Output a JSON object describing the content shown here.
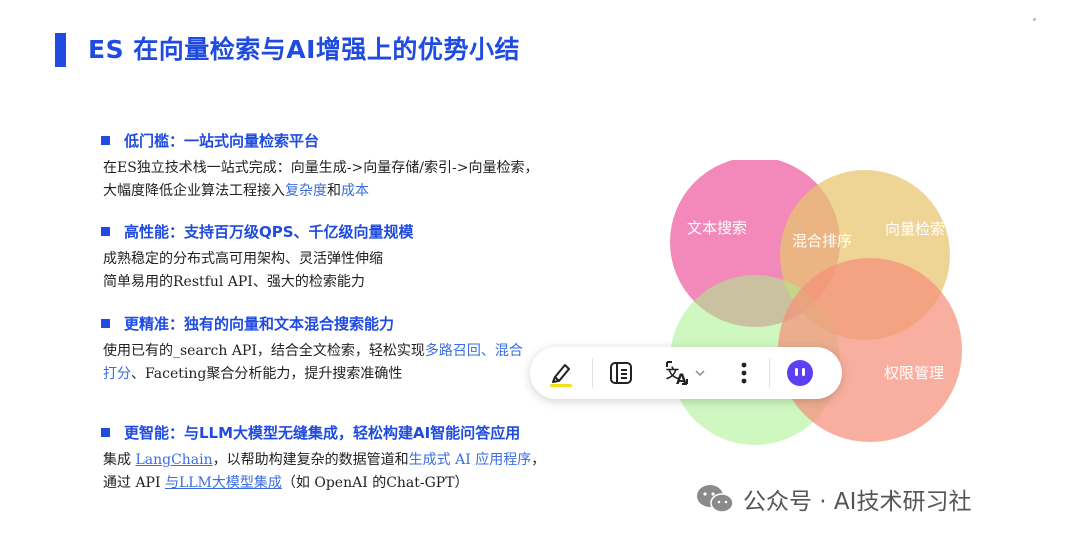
{
  "slide": {
    "title": "ES 在向量检索与AI增强上的优势小结",
    "sections": [
      {
        "heading": "低门槛：一站式向量检索平台",
        "line1": "在ES独立技术栈一站式完成：向量生成->向量存储/索引->向量检索，",
        "line2_a": "大幅度降低企业算法工程接入",
        "line2_link1": "复杂度",
        "line2_mid": "和",
        "line2_link2": "成本"
      },
      {
        "heading": "高性能：支持百万级QPS、千亿级向量规模",
        "line1": "成熟稳定的分布式高可用架构、灵活弹性伸缩",
        "line2": "简单易用的Restful API、强大的检索能力"
      },
      {
        "heading": "更精准：独有的向量和文本混合搜索能力",
        "line1_a": "使用已有的_search API，结合全文检索，轻松实现",
        "line1_link": "多路召回、混合",
        "line2_link": "打分",
        "line2_b": "、Faceting聚合分析能力，提升搜索准确性"
      },
      {
        "heading": "更智能：与LLM大模型无缝集成，轻松构建AI智能问答应用",
        "line1_a": "集成 ",
        "line1_link1": "LangChain",
        "line1_mid": "，以帮助构建复杂的数据管道和",
        "line1_link2": "生成式 AI 应用程序",
        "line1_end": "，",
        "line2_a": "通过 API ",
        "line2_link": "与LLM大模型集成",
        "line2_b": "（如 OpenAI 的Chat-GPT）"
      }
    ]
  },
  "venn": {
    "labels": {
      "text_search": "文本搜索",
      "hybrid_rank": "混合排序",
      "vector_search": "向量检索",
      "permission": "权限管理"
    },
    "colors": {
      "pink": "#f067a6",
      "yellow": "#e8c56e",
      "green": "#a8f08c",
      "salmon": "#f7907a"
    }
  },
  "toolbar": {
    "icons": [
      "highlighter-icon",
      "notes-icon",
      "translate-icon",
      "chevron-down-icon",
      "more-icon",
      "assistant-icon"
    ]
  },
  "watermark": {
    "text": "公众号 · AI技术研习社"
  },
  "colors": {
    "accent": "#1f4be0",
    "link": "#3a6de0"
  }
}
